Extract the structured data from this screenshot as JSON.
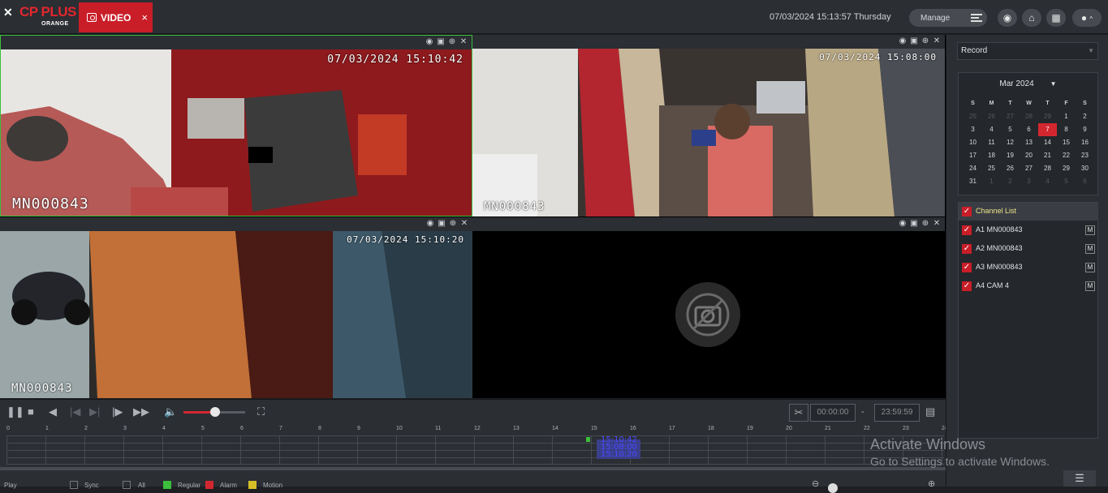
{
  "brand": {
    "name": "CP PLUS",
    "sub": "ORANGE"
  },
  "tab": {
    "label": "VIDEO",
    "close": "×"
  },
  "datetime": "07/03/2024 15:13:57 Thursday",
  "manage_label": "Manage",
  "panes": [
    {
      "time": "07/03/2024 15:10:42",
      "name": "MN000843"
    },
    {
      "time": "07/03/2024 15:08:00",
      "name": "MN000843"
    },
    {
      "time": "07/03/2024 15:10:20",
      "name": "MN000843"
    },
    {
      "time": "",
      "name": ""
    }
  ],
  "range": {
    "start": "00:00:00",
    "sep": "-",
    "end": "23:59:59"
  },
  "timeline": {
    "hours": [
      "0",
      "1",
      "2",
      "3",
      "4",
      "5",
      "6",
      "7",
      "8",
      "9",
      "10",
      "11",
      "12",
      "13",
      "14",
      "15",
      "16",
      "17",
      "18",
      "19",
      "20",
      "21",
      "22",
      "23",
      "24"
    ],
    "records": [
      "15:10:42",
      "15:08:00",
      "15:10:20"
    ]
  },
  "footer": {
    "play": "Play",
    "sync": "Sync",
    "all": "All",
    "regular": "Regular",
    "alarm": "Alarm",
    "motion": "Motion"
  },
  "record_select": "Record",
  "calendar": {
    "month": "Mar 2024",
    "weekdays": [
      "S",
      "M",
      "T",
      "W",
      "T",
      "F",
      "S"
    ],
    "days": [
      "25",
      "26",
      "27",
      "28",
      "29",
      "1",
      "2",
      "3",
      "4",
      "5",
      "6",
      "7",
      "8",
      "9",
      "10",
      "11",
      "12",
      "13",
      "14",
      "15",
      "16",
      "17",
      "18",
      "19",
      "20",
      "21",
      "22",
      "23",
      "24",
      "25",
      "26",
      "27",
      "28",
      "29",
      "30",
      "31",
      "1",
      "2",
      "3",
      "4",
      "5",
      "6"
    ],
    "selected": "7"
  },
  "channels": {
    "header": "Channel List",
    "items": [
      {
        "label": "A1 MN000843",
        "mode": "M"
      },
      {
        "label": "A2 MN000843",
        "mode": "M"
      },
      {
        "label": "A3 MN000843",
        "mode": "M"
      },
      {
        "label": "A4 CAM 4",
        "mode": "M"
      }
    ]
  },
  "watermark": {
    "line1": "Activate Windows",
    "line2": "Go to Settings to activate Windows."
  },
  "colors": {
    "accent": "#c91d28",
    "active_border": "#3cbf3c",
    "record": "#3a3f8a"
  }
}
